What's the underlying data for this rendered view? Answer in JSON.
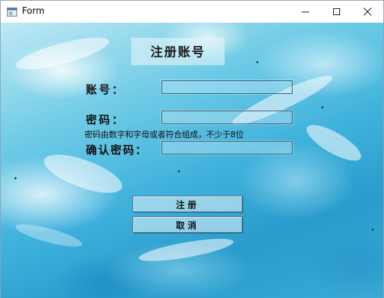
{
  "window": {
    "title": "Form",
    "icon": "app-window-icon",
    "controls": [
      "minimize-icon",
      "maximize-icon",
      "close-icon"
    ]
  },
  "form": {
    "heading": "注册账号",
    "account_label": "账号：",
    "account_value": "",
    "password_label": "密码：",
    "password_value": "",
    "password_hint": "密码由数字和字母或者符合组成，不少于8位",
    "confirm_label": "确认密码：",
    "confirm_value": "",
    "register_button": "注册",
    "cancel_button": "取消"
  }
}
